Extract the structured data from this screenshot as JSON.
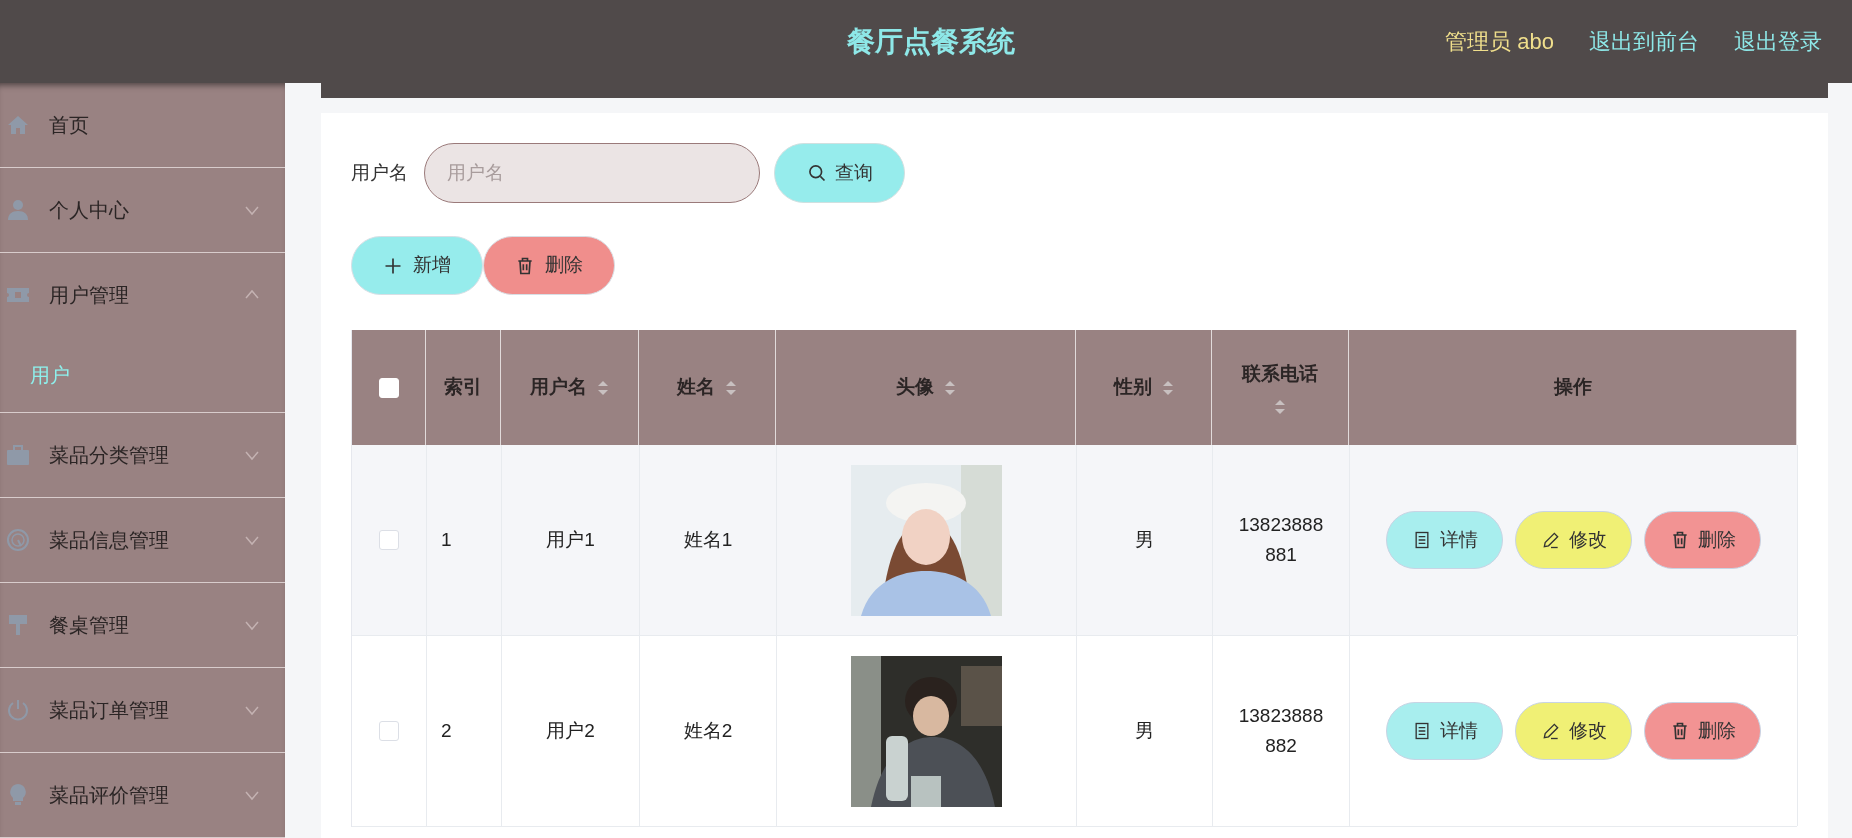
{
  "header": {
    "title": "餐厅点餐系统",
    "user": "管理员 abo",
    "links": [
      "退出到前台",
      "退出登录"
    ]
  },
  "sidebar": {
    "items": [
      {
        "label": "首页"
      },
      {
        "label": "个人中心",
        "expanded": false
      },
      {
        "label": "用户管理",
        "expanded": true,
        "children": [
          {
            "label": "用户",
            "selected": true
          }
        ]
      },
      {
        "label": "菜品分类管理",
        "expanded": false
      },
      {
        "label": "菜品信息管理",
        "expanded": false
      },
      {
        "label": "餐桌管理",
        "expanded": false
      },
      {
        "label": "菜品订单管理",
        "expanded": false
      },
      {
        "label": "菜品评价管理",
        "expanded": false
      }
    ]
  },
  "search": {
    "label": "用户名",
    "placeholder": "用户名",
    "button": "查询"
  },
  "toolbar": [
    {
      "label": "新增",
      "kind": "add"
    },
    {
      "label": "删除",
      "kind": "delete"
    }
  ],
  "table": {
    "select_all": {
      "checked": false
    },
    "columns": [
      {
        "label": "索引",
        "sortable": false
      },
      {
        "label": "用户名",
        "sortable": true
      },
      {
        "label": "姓名",
        "sortable": true
      },
      {
        "label": "头像",
        "sortable": true
      },
      {
        "label": "性别",
        "sortable": true
      },
      {
        "label": "联系电话",
        "sortable": true
      },
      {
        "label": "操作",
        "sortable": false
      }
    ],
    "rows": [
      {
        "checked": false,
        "index": "1",
        "username": "用户1",
        "name": "姓名1",
        "gender": "男",
        "phone": "13823888881",
        "actions": [
          {
            "label": "详情",
            "kind": "detail"
          },
          {
            "label": "修改",
            "kind": "edit"
          },
          {
            "label": "删除",
            "kind": "delete"
          }
        ]
      },
      {
        "checked": false,
        "index": "2",
        "username": "用户2",
        "name": "姓名2",
        "gender": "男",
        "phone": "13823888882",
        "actions": [
          {
            "label": "详情",
            "kind": "detail"
          },
          {
            "label": "修改",
            "kind": "edit"
          },
          {
            "label": "删除",
            "kind": "delete"
          }
        ]
      }
    ]
  }
}
